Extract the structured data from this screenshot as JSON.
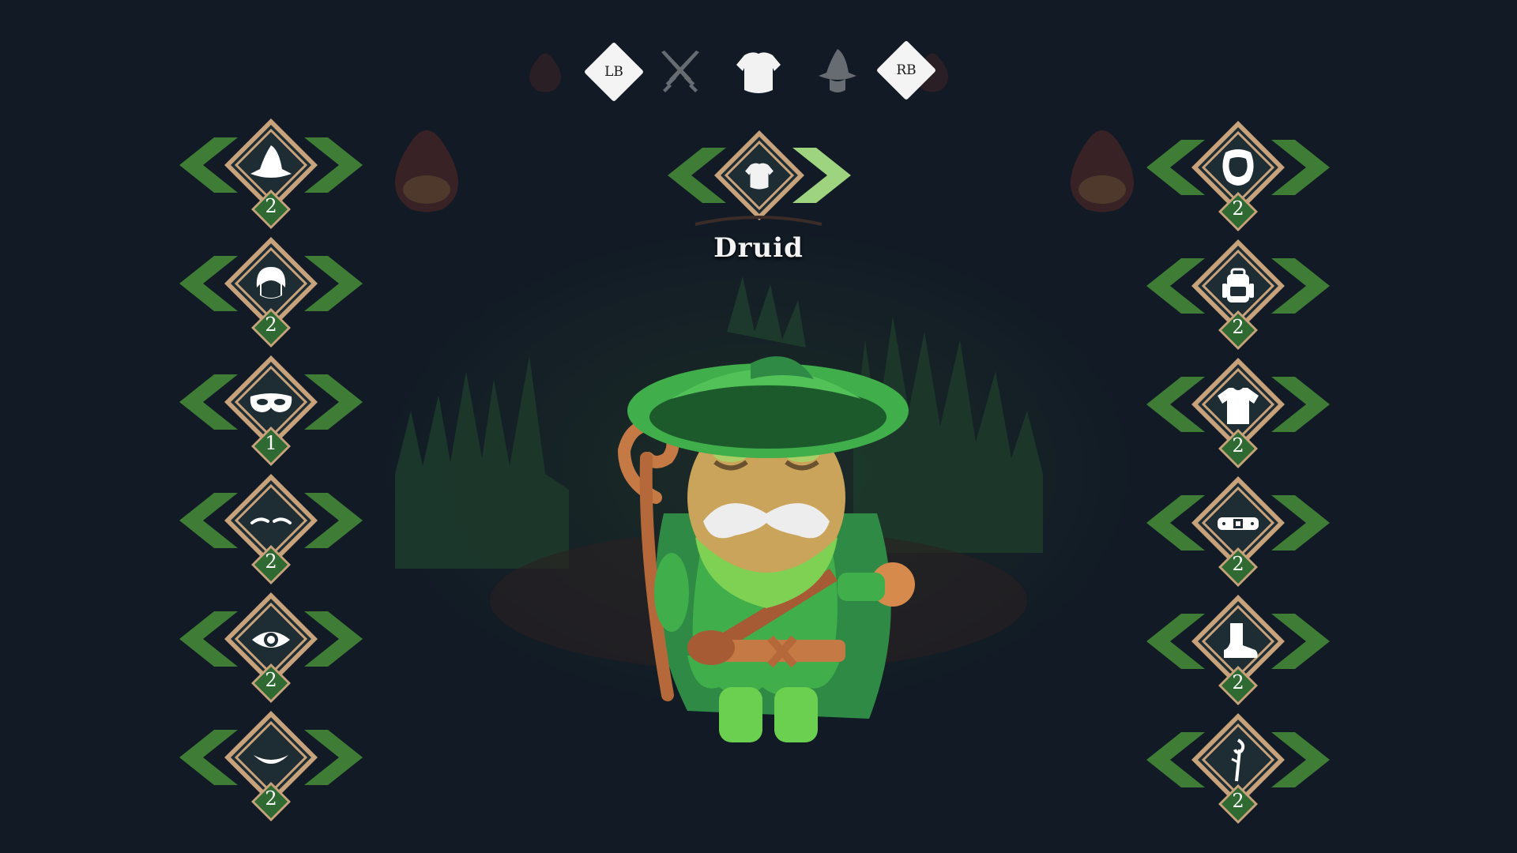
{
  "title": "Druid",
  "tabs": {
    "left_shoulder": "LB",
    "right_shoulder": "RB",
    "icons": [
      "crossed-swords-icon",
      "armor-icon",
      "wizard-hat-icon"
    ],
    "active": "armor-icon"
  },
  "center_selector": {
    "icon": "armor-icon"
  },
  "left_column": [
    {
      "icon": "wizard-hat-icon",
      "count": "2"
    },
    {
      "icon": "hair-icon",
      "count": "2"
    },
    {
      "icon": "mask-icon",
      "count": "1"
    },
    {
      "icon": "eyebrows-icon",
      "count": "2"
    },
    {
      "icon": "eye-icon",
      "count": "2"
    },
    {
      "icon": "mouth-icon",
      "count": "2"
    }
  ],
  "right_column": [
    {
      "icon": "beard-icon",
      "count": "2"
    },
    {
      "icon": "backpack-icon",
      "count": "2"
    },
    {
      "icon": "shirt-icon",
      "count": "2"
    },
    {
      "icon": "belt-icon",
      "count": "2"
    },
    {
      "icon": "boot-icon",
      "count": "2"
    },
    {
      "icon": "staff-icon",
      "count": "2"
    }
  ],
  "colors": {
    "background": "#111a25",
    "arrow_green": "#3f7d36",
    "arrow_highlight": "#9ed37f",
    "frame_gold": "#c8a27a",
    "diamond_fill": "#1e2c34",
    "count_green": "#2f6a33"
  }
}
